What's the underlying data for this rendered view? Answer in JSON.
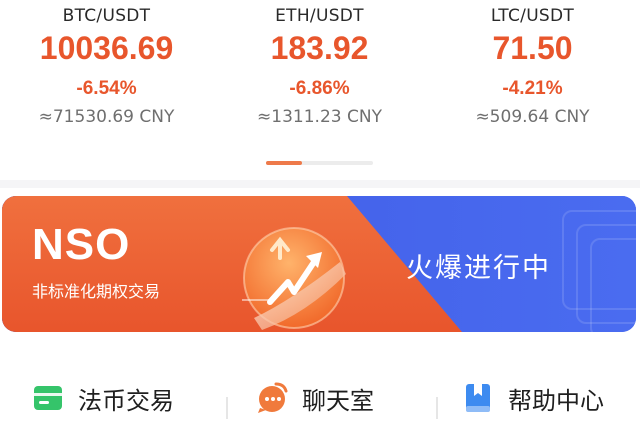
{
  "tickers": [
    {
      "pair": "BTC/USDT",
      "price": "10036.69",
      "change": "-6.54%",
      "cny": "≈71530.69 CNY"
    },
    {
      "pair": "ETH/USDT",
      "price": "183.92",
      "change": "-6.86%",
      "cny": "≈1311.23 CNY"
    },
    {
      "pair": "LTC/USDT",
      "price": "71.50",
      "change": "-4.21%",
      "cny": "≈509.64 CNY"
    }
  ],
  "pager": {
    "pages": 3,
    "active_index": 0
  },
  "banner": {
    "title": "NSO",
    "subtitle": "非标准化期权交易",
    "cta": "火爆进行中"
  },
  "shortcuts": [
    {
      "label": "法币交易",
      "icon": "wallet-icon"
    },
    {
      "label": "聊天室",
      "icon": "chat-bubble-icon"
    },
    {
      "label": "帮助中心",
      "icon": "bookmark-book-icon"
    }
  ],
  "colors": {
    "accent_down": "#e8562c",
    "banner_orange": "#ee6a3a",
    "banner_blue": "#3f5be6",
    "wallet_green": "#35c46a",
    "chat_orange": "#f07a3c",
    "help_blue": "#3d8bf0"
  }
}
